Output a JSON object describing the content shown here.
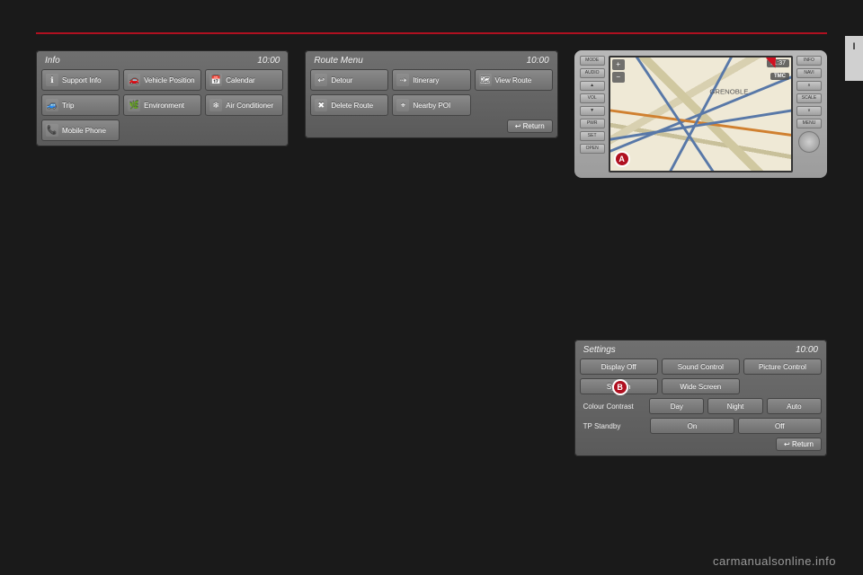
{
  "page_tab": "I",
  "info_panel": {
    "title": "Info",
    "clock": "10:00",
    "buttons": [
      {
        "icon": "ℹ",
        "label": "Support Info",
        "name": "support-info-button"
      },
      {
        "icon": "🚗",
        "label": "Vehicle Position",
        "name": "vehicle-position-button"
      },
      {
        "icon": "📅",
        "label": "Calendar",
        "name": "calendar-button"
      },
      {
        "icon": "🚙",
        "label": "Trip",
        "name": "trip-button"
      },
      {
        "icon": "🌿",
        "label": "Environment",
        "name": "environment-button"
      },
      {
        "icon": "❄",
        "label": "Air Conditioner",
        "name": "air-conditioner-button"
      },
      {
        "icon": "📞",
        "label": "Mobile Phone",
        "name": "mobile-phone-button"
      }
    ]
  },
  "route_panel": {
    "title": "Route Menu",
    "clock": "10:00",
    "buttons": [
      {
        "icon": "↩",
        "label": "Detour",
        "name": "detour-button"
      },
      {
        "icon": "⇢",
        "label": "Itinerary",
        "name": "itinerary-button"
      },
      {
        "icon": "🗺",
        "label": "View Route",
        "name": "view-route-button"
      },
      {
        "icon": "✖",
        "label": "Delete Route",
        "name": "delete-route-button"
      },
      {
        "icon": "⌖",
        "label": "Nearby POI",
        "name": "nearby-poi-button"
      }
    ],
    "return": "Return"
  },
  "settings_panel": {
    "title": "Settings",
    "clock": "10:00",
    "row1": [
      {
        "label": "Display Off",
        "name": "display-off-button"
      },
      {
        "label": "Sound Control",
        "name": "sound-control-button"
      },
      {
        "label": "Picture Control",
        "name": "picture-control-button"
      }
    ],
    "row2": [
      {
        "label": "System",
        "name": "system-button"
      },
      {
        "label": "Wide Screen",
        "name": "wide-screen-button"
      }
    ],
    "colour_contrast": {
      "label": "Colour Contrast",
      "options": [
        "Day",
        "Night",
        "Auto"
      ]
    },
    "tp_standby": {
      "label": "TP Standby",
      "options": [
        "On",
        "Off"
      ]
    },
    "return": "Return",
    "marker": "B"
  },
  "device": {
    "left_buttons": [
      "MODE",
      "AUDIO",
      "▲",
      "VOL",
      "▼",
      "PWR",
      "SET",
      "OPEN"
    ],
    "right_buttons": [
      "INFO",
      "NAVI",
      "∧",
      "SCALE",
      "∨",
      "MENU"
    ],
    "map": {
      "clock": "11:37",
      "tmc": "TMC",
      "city_label": "GRENOBLE",
      "marker": "A"
    }
  },
  "watermark": "carmanualsonline.info"
}
